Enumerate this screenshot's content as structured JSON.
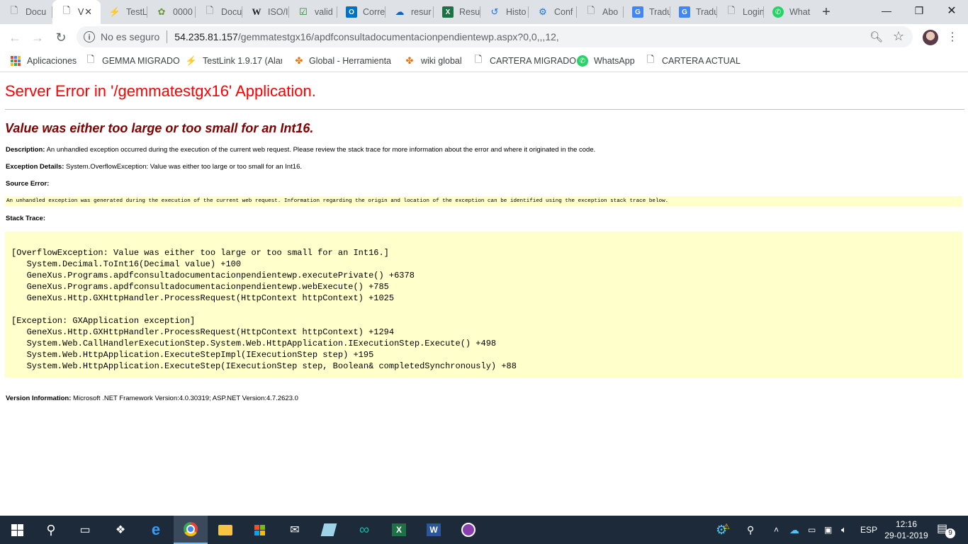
{
  "browser": {
    "tabs": [
      {
        "label": "Docu",
        "icon": "doc-icon",
        "active": false
      },
      {
        "label": "V",
        "icon": "doc-icon",
        "active": true
      },
      {
        "label": "TestL",
        "icon": "testlink-icon",
        "active": false
      },
      {
        "label": "0000",
        "icon": "bug-icon",
        "active": false
      },
      {
        "label": "Docu",
        "icon": "doc-icon",
        "active": false
      },
      {
        "label": "ISO/I",
        "icon": "wikipedia-icon",
        "active": false
      },
      {
        "label": "valid",
        "icon": "check-icon",
        "active": false
      },
      {
        "label": "Corre",
        "icon": "outlook-icon",
        "active": false
      },
      {
        "label": "resur",
        "icon": "onedrive-icon",
        "active": false
      },
      {
        "label": "Resu",
        "icon": "excel-icon",
        "active": false
      },
      {
        "label": "Histo",
        "icon": "history-icon",
        "active": false
      },
      {
        "label": "Conf",
        "icon": "settings-icon",
        "active": false
      },
      {
        "label": "Abo",
        "icon": "doc-icon",
        "active": false
      },
      {
        "label": "Tradu",
        "icon": "translate-icon",
        "active": false
      },
      {
        "label": "Tradu",
        "icon": "translate-icon",
        "active": false
      },
      {
        "label": "Login",
        "icon": "doc-icon",
        "active": false
      },
      {
        "label": "What",
        "icon": "whatsapp-icon",
        "active": false
      }
    ],
    "close_glyph": "✕",
    "new_tab": "+",
    "window_controls": {
      "minimize": "—",
      "maximize": "❐",
      "close": "✕"
    },
    "address": {
      "security": "No es seguro",
      "host": "54.235.81.157",
      "path": "/gemmatestgx16/apdfconsultadocumentacionpendientewp.aspx?0,0,,,12,"
    },
    "bookmarks": [
      {
        "label": "Aplicaciones",
        "icon": "apps-icon"
      },
      {
        "label": "GEMMA MIGRADO",
        "icon": "doc-icon"
      },
      {
        "label": "TestLink 1.9.17 (Alan",
        "icon": "testlink-icon"
      },
      {
        "label": "Global - Herramienta",
        "icon": "global-icon"
      },
      {
        "label": "wiki global",
        "icon": "global-icon"
      },
      {
        "label": "CARTERA MIGRADO",
        "icon": "doc-icon"
      },
      {
        "label": "WhatsApp",
        "icon": "whatsapp-icon"
      },
      {
        "label": "CARTERA ACTUAL",
        "icon": "doc-icon"
      }
    ]
  },
  "page": {
    "title": "Server Error in '/gemmatestgx16' Application.",
    "message": "Value was either too large or too small for an Int16.",
    "description_label": "Description:",
    "description": "An unhandled exception occurred during the execution of the current web request. Please review the stack trace for more information about the error and where it originated in the code.",
    "exception_label": "Exception Details:",
    "exception": "System.OverflowException: Value was either too large or too small for an Int16.",
    "source_label": "Source Error:",
    "source_text": "An unhandled exception was generated during the execution of the current web request. Information regarding the origin and location of the exception can be identified using the exception stack trace below.",
    "stack_label": "Stack Trace:",
    "stack_trace": "[OverflowException: Value was either too large or too small for an Int16.]\n   System.Decimal.ToInt16(Decimal value) +100\n   GeneXus.Programs.apdfconsultadocumentacionpendientewp.executePrivate() +6378\n   GeneXus.Programs.apdfconsultadocumentacionpendientewp.webExecute() +785\n   GeneXus.Http.GXHttpHandler.ProcessRequest(HttpContext httpContext) +1025\n\n[Exception: GXApplication exception]\n   GeneXus.Http.GXHttpHandler.ProcessRequest(HttpContext httpContext) +1294\n   System.Web.CallHandlerExecutionStep.System.Web.HttpApplication.IExecutionStep.Execute() +498\n   System.Web.HttpApplication.ExecuteStepImpl(IExecutionStep step) +195\n   System.Web.HttpApplication.ExecuteStep(IExecutionStep step, Boolean& completedSynchronously) +88",
    "version_label": "Version Information:",
    "version": "Microsoft .NET Framework Version:4.0.30319; ASP.NET Version:4.7.2623.0"
  },
  "taskbar": {
    "apps": [
      "start-icon",
      "search-icon",
      "task-view-icon",
      "dropbox-icon",
      "edge-icon",
      "chrome-icon",
      "file-explorer-icon",
      "store-icon",
      "mail-icon",
      "app-icon",
      "arduino-icon",
      "excel-icon",
      "word-icon",
      "app-icon"
    ],
    "language": "ESP",
    "time": "12:16",
    "date": "29-01-2019",
    "notifications": "9"
  },
  "colors": {
    "error_title": "#ff0000",
    "error_message": "#800000",
    "code_background": "#ffffcc",
    "taskbar": "#1c2a3a",
    "tabstrip": "#dee1e6"
  }
}
